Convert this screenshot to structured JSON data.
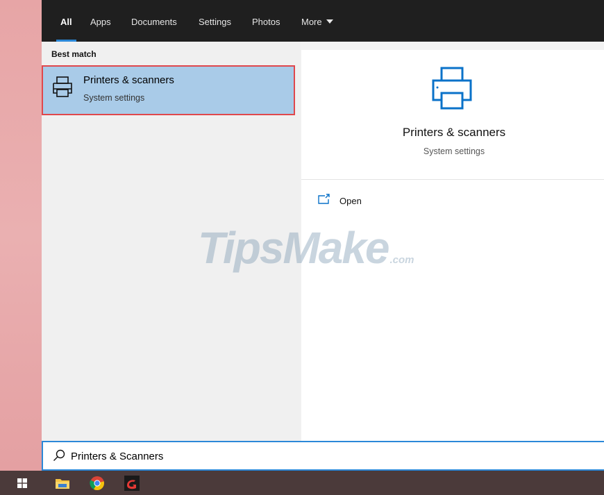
{
  "tabs": [
    {
      "label": "All",
      "active": true
    },
    {
      "label": "Apps"
    },
    {
      "label": "Documents"
    },
    {
      "label": "Settings"
    },
    {
      "label": "Photos"
    },
    {
      "label": "More"
    }
  ],
  "results": {
    "section_label": "Best match",
    "best_match": {
      "title": "Printers & scanners",
      "subtitle": "System settings",
      "icon": "printer-icon"
    }
  },
  "detail": {
    "title": "Printers & scanners",
    "subtitle": "System settings",
    "icon": "printer-icon",
    "actions": [
      {
        "label": "Open",
        "icon": "open-window-icon"
      }
    ]
  },
  "watermark": {
    "main": "TipsMake",
    "suffix": ".com"
  },
  "search": {
    "value": "Printers & Scanners"
  },
  "taskbar": {
    "items": [
      "windows-start-icon",
      "file-explorer-icon",
      "chrome-icon",
      "app-icon"
    ]
  },
  "colors": {
    "accent": "#2b88d8",
    "selection": "#a9cbe8",
    "highlight_border": "#e0474c",
    "tabbar": "#1f1f1f",
    "taskbar": "#4b3a3a"
  }
}
